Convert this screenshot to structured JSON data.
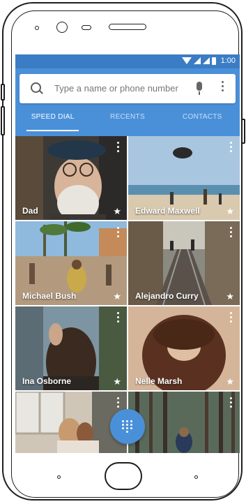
{
  "status_bar": {
    "time": "1:00"
  },
  "search": {
    "placeholder": "Type a name or phone number"
  },
  "tabs": [
    {
      "label": "SPEED DIAL",
      "active": true
    },
    {
      "label": "RECENTS",
      "active": false
    },
    {
      "label": "CONTACTS",
      "active": false
    }
  ],
  "contacts": [
    {
      "name": "Dad",
      "starred": true
    },
    {
      "name": "Edward Maxwell",
      "starred": true
    },
    {
      "name": "Michael Bush",
      "starred": true
    },
    {
      "name": "Alejandro Curry",
      "starred": true
    },
    {
      "name": "Ina Osborne",
      "starred": true
    },
    {
      "name": "Nelle Marsh",
      "starred": true
    },
    {
      "name": "",
      "starred": false
    },
    {
      "name": "",
      "starred": false
    }
  ],
  "colors": {
    "accent": "#4a90d9",
    "statusbar": "#3b7dc4",
    "text_on_accent": "#ffffff"
  },
  "icons": {
    "search": "search-icon",
    "mic": "mic-icon",
    "more": "more-vert-icon",
    "star": "star-icon",
    "dialpad": "dialpad-icon"
  },
  "star_glyph": "★"
}
